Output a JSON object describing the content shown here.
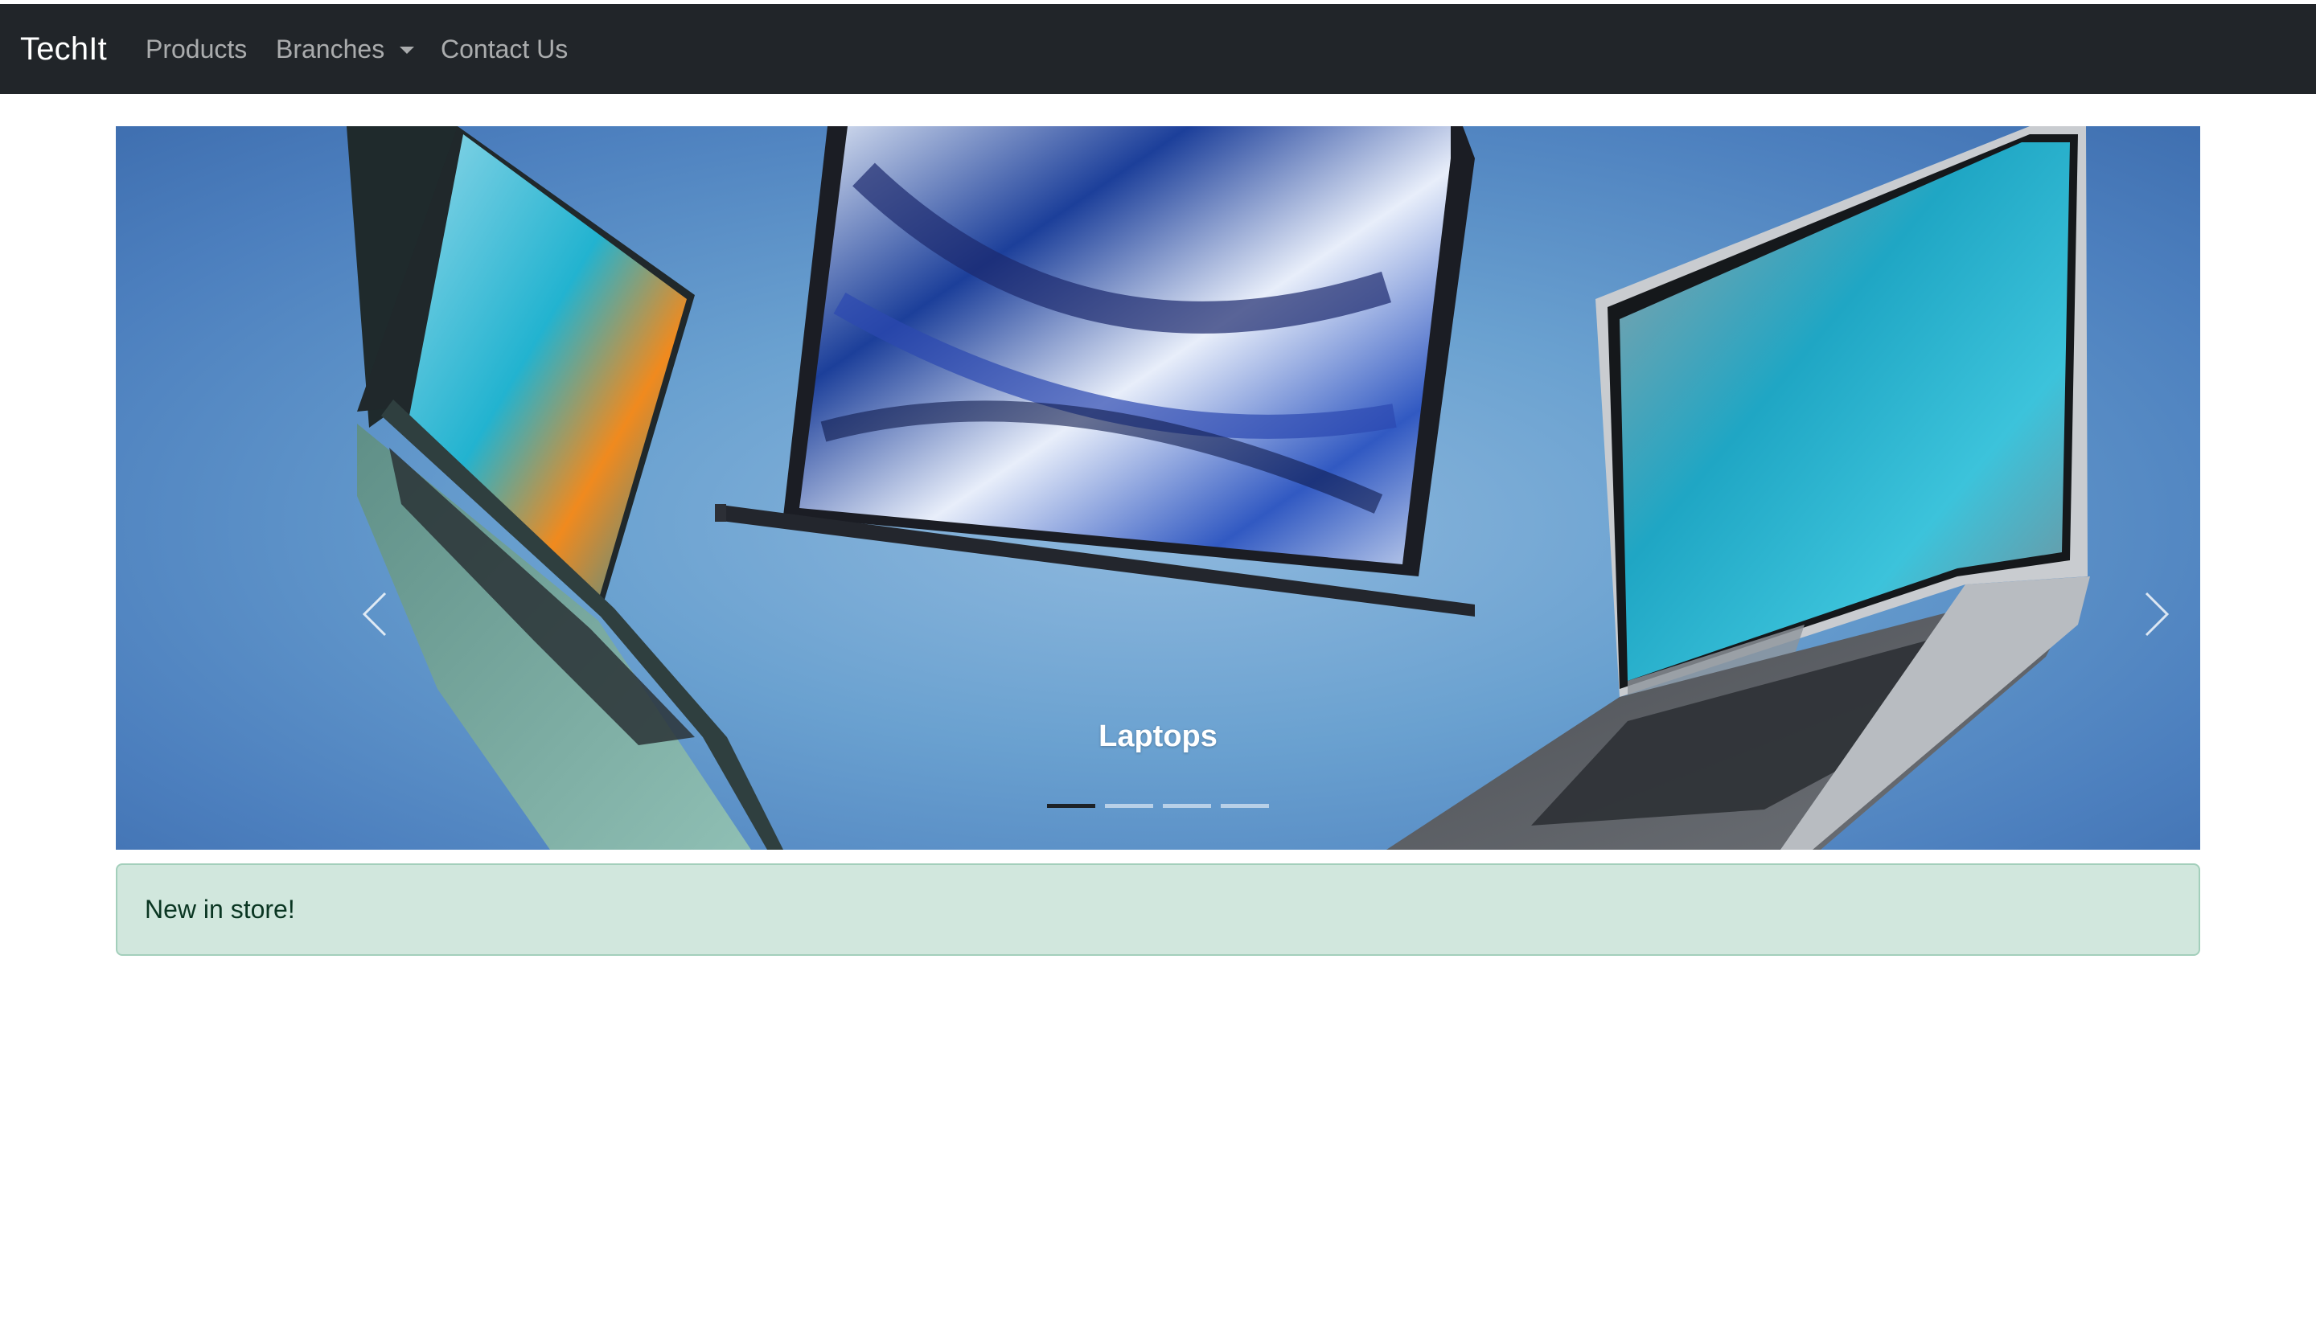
{
  "navbar": {
    "brand": "TechIt",
    "links": [
      {
        "label": "Products"
      },
      {
        "label": "Branches",
        "dropdown": true
      },
      {
        "label": "Contact Us"
      }
    ]
  },
  "carousel": {
    "caption": "Laptops",
    "indicator_count": 4,
    "active_index": 0,
    "prev_icon": "chevron-left-icon",
    "next_icon": "chevron-right-icon"
  },
  "alert": {
    "text": "New in store!"
  },
  "colors": {
    "navbar_bg": "#212529",
    "alert_bg": "#d1e7dd",
    "alert_border": "#a3cfbb",
    "alert_text": "#0a3622"
  }
}
